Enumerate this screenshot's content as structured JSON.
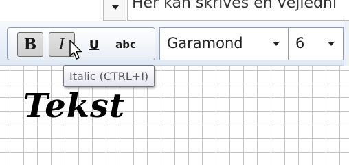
{
  "top_field": {
    "hint_text": "Her kan skrives en vejledni"
  },
  "toolbar": {
    "bold_label": "B",
    "italic_label": "I",
    "underline_label": "U",
    "strike_label": "abc",
    "font_value": "Garamond",
    "size_value": "6"
  },
  "tooltip": {
    "text": "Italic (CTRL+I)"
  },
  "canvas": {
    "text": "Tekst"
  },
  "icons": {
    "cursor": "mouse-pointer-icon",
    "dropdown": "chevron-down-icon"
  }
}
